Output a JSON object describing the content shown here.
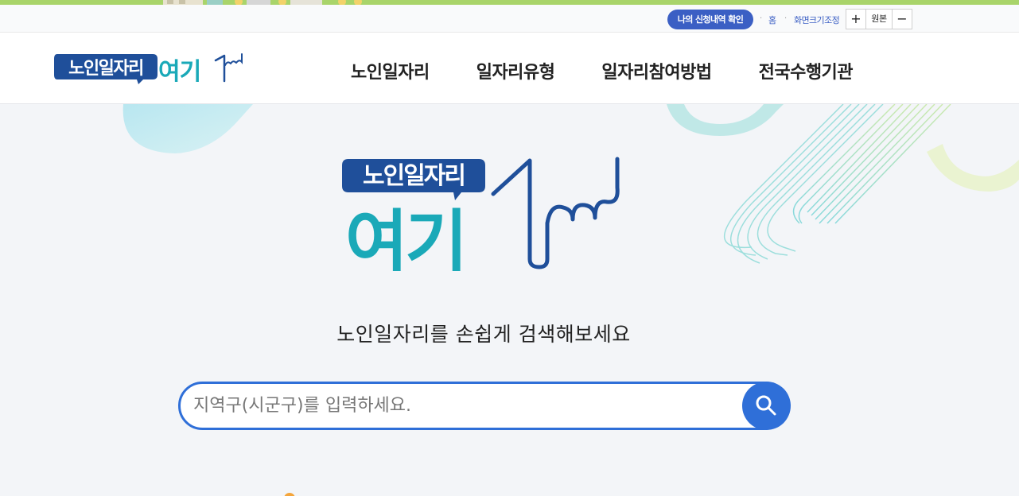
{
  "colors": {
    "top_stripe": "#a9d46a",
    "primary_blue": "#3b5fc4",
    "search_blue": "#2f6fd8",
    "logo_navy": "#1f4f9a",
    "logo_teal": "#1aa9b8",
    "background": "#f3f5f8"
  },
  "util": {
    "mypage_label": "나의 신청내역 확인",
    "home_label": "홈",
    "zoom_label": "화면크기조정",
    "zoom_in_label": "+",
    "zoom_reset_label": "원본",
    "zoom_out_label": "−"
  },
  "header": {
    "logo": {
      "badge_text": "노인일자리",
      "word_text": "여기"
    },
    "nav": [
      "노인일자리",
      "일자리유형",
      "일자리참여방법",
      "전국수행기관"
    ]
  },
  "hero": {
    "logo": {
      "badge_text": "노인일자리",
      "word_text": "여기"
    },
    "tagline": "노인일자리를 손쉽게 검색해보세요",
    "search": {
      "placeholder": "지역구(시군구)를 입력하세요.",
      "value": "",
      "button_icon": "search-icon"
    }
  }
}
